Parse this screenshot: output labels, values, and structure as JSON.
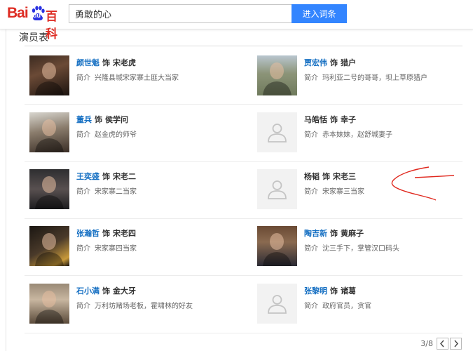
{
  "header": {
    "logo": {
      "bai": "Bai",
      "du": "du",
      "baike": "百科"
    },
    "search_value": "勇敢的心",
    "search_button": "进入词条"
  },
  "section": {
    "title": "演员表"
  },
  "cast": [
    {
      "actor": "颜世魁",
      "linked": true,
      "as": "饰",
      "role": "宋老虎",
      "intro_label": "简介",
      "intro": "兴隆县城宋家寨土匪大当家",
      "photo": "portrait-1"
    },
    {
      "actor": "贾宏伟",
      "linked": true,
      "as": "饰",
      "role": "猎户",
      "intro_label": "简介",
      "intro": "玛利亚二号的哥哥，坝上草原猎户",
      "photo": "portrait-2"
    },
    {
      "actor": "董兵",
      "linked": true,
      "as": "饰",
      "role": "侯学问",
      "intro_label": "简介",
      "intro": "赵金虎的师爷",
      "photo": "portrait-3"
    },
    {
      "actor": "马皓恬",
      "linked": false,
      "as": "饰",
      "role": "幸子",
      "intro_label": "简介",
      "intro": "赤本妹妹，赵舒城妻子",
      "photo": "placeholder"
    },
    {
      "actor": "王奕盛",
      "linked": true,
      "as": "饰",
      "role": "宋老二",
      "intro_label": "简介",
      "intro": "宋家寨二当家",
      "photo": "portrait-5"
    },
    {
      "actor": "杨韬",
      "linked": false,
      "as": "饰",
      "role": "宋老三",
      "intro_label": "简介",
      "intro": "宋家寨三当家",
      "photo": "placeholder"
    },
    {
      "actor": "张瀚哲",
      "linked": true,
      "as": "饰",
      "role": "宋老四",
      "intro_label": "简介",
      "intro": "宋家寨四当家",
      "photo": "portrait-7"
    },
    {
      "actor": "陶吉新",
      "linked": true,
      "as": "饰",
      "role": "黄麻子",
      "intro_label": "简介",
      "intro": "沈三手下，掌管汉口码头",
      "photo": "portrait-8"
    },
    {
      "actor": "石小满",
      "linked": true,
      "as": "饰",
      "role": "金大牙",
      "intro_label": "简介",
      "intro": "万利坊赌场老板，霍啸林的好友",
      "photo": "portrait-9"
    },
    {
      "actor": "张黎明",
      "linked": true,
      "as": "饰",
      "role": "诸葛",
      "intro_label": "简介",
      "intro": "政府官员，贪官",
      "photo": "placeholder"
    }
  ],
  "pager": {
    "page": "3/8",
    "prev": "prev",
    "next": "next"
  },
  "colors": {
    "accent": "#3385ff",
    "link": "#136ec2",
    "logo_red": "#de2c23",
    "annotation": "#e0281e"
  },
  "icons": {
    "paw": "paw-icon",
    "placeholder": "person-placeholder-icon",
    "prev": "chevron-left-icon",
    "next": "chevron-right-icon"
  }
}
